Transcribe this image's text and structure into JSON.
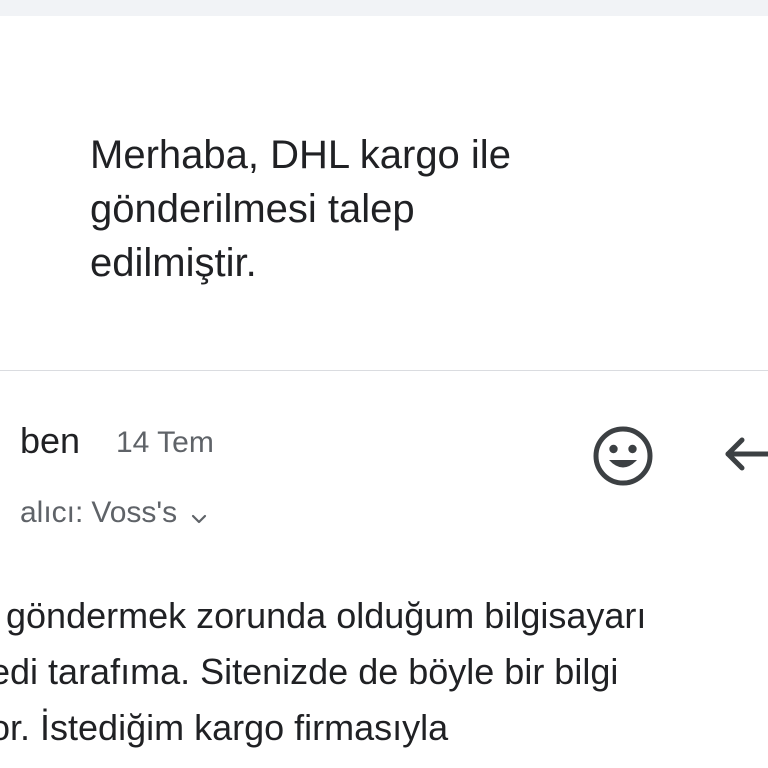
{
  "quoted_message": {
    "lines": [
      "Merhaba, DHL kargo ile",
      "gönderilmesi talep",
      "edilmiştir."
    ]
  },
  "header": {
    "sender": "ben",
    "date": "14 Tem",
    "recipient_prefix": "alıcı:",
    "recipient": "Voss's",
    "icons": {
      "emoji": "smiley-face-icon",
      "reply": "reply-arrow-icon",
      "expand": "chevron-down-icon"
    }
  },
  "body": {
    "lines": [
      "göndermek zorunda olduğum bilgisayarı",
      "edi tarafıma. Sitenizde de böyle bir bilgi",
      "or. İstediğim kargo firmasıyla"
    ]
  }
}
